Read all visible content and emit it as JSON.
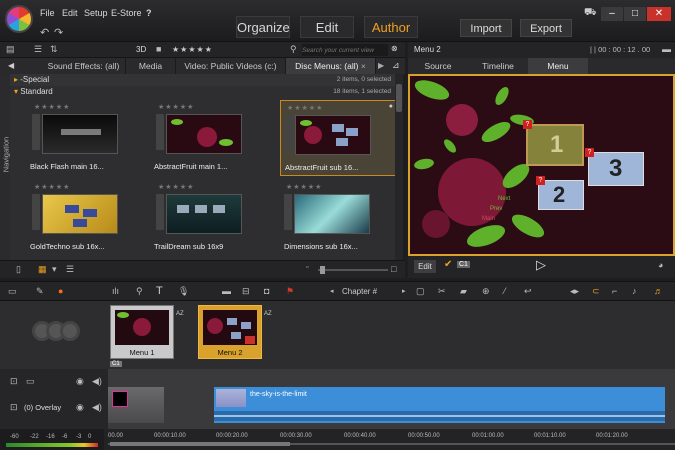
{
  "menubar": {
    "file": "File",
    "edit": "Edit",
    "setup": "Setup",
    "estore": "E-Store",
    "help_icon": "?"
  },
  "nav": {
    "organize": "Organize",
    "edit": "Edit",
    "author": "Author",
    "accent": "#f0a020"
  },
  "topbuttons": {
    "import": "Import",
    "export": "Export"
  },
  "window": {
    "minimize": "–",
    "maximize": "□",
    "close": "✕"
  },
  "libtoolbar": {
    "mode_3d": "3D",
    "rating": "★★★★★",
    "search_placeholder": "Search your current view"
  },
  "libtabs": [
    "Sound Effects: (all)",
    "Media",
    "Video: Public Videos (c:)",
    "Disc Menus: (all)"
  ],
  "navigation_label": "Navigation",
  "groups": [
    {
      "name": "-Special",
      "count": "2 items, 0 selected"
    },
    {
      "name": "Standard",
      "count": "18 items, 1 selected"
    }
  ],
  "tiles": [
    {
      "label": "Black Flash main 16...",
      "stars": "★★★★★",
      "thumb": "black"
    },
    {
      "label": "AbstractFruit main 1...",
      "stars": "★★★★★",
      "thumb": "fruit"
    },
    {
      "label": "AbstractFruit sub 16...",
      "stars": "★★★★★",
      "thumb": "fruitsub",
      "selected": true
    },
    {
      "label": "GoldTechno sub 16x...",
      "stars": "★★★★★",
      "thumb": "gold"
    },
    {
      "label": "TrailDream sub 16x9",
      "stars": "★★★★★",
      "thumb": "trail"
    },
    {
      "label": "Dimensions sub 16x...",
      "stars": "★★★★★",
      "thumb": "dim"
    }
  ],
  "preview": {
    "title": "Menu 2",
    "timecode": "| | 00 : 00 : 12 . 00",
    "tabs": [
      "Source",
      "Timeline",
      "Menu"
    ],
    "buttons": [
      {
        "num": "1",
        "badge": "?"
      },
      {
        "num": "2",
        "badge": "?"
      },
      {
        "num": "3",
        "badge": "?"
      }
    ],
    "next_text": "Next",
    "prev_text": "Prev",
    "main_text": "Main",
    "edit_label": "Edit",
    "c1_label": "C1"
  },
  "timeline": {
    "chapter_label": "Chapter #",
    "menus": [
      {
        "label": "Menu 1",
        "tag": "AZ"
      },
      {
        "label": "Menu 2",
        "tag": "AZ",
        "selected": true
      }
    ],
    "c1_marker": "C1",
    "overlay_track": "(0) Overlay",
    "clip_title": "the-sky-is-the-limit",
    "ruler": [
      "00.00",
      "00:00:10.00",
      "00:00:20.00",
      "00:00:30.00",
      "00:00:40.00",
      "00:00:50.00",
      "00:01:00.00",
      "00:01:10.00",
      "00:01:20.00"
    ],
    "meter": [
      "-60",
      "-22",
      "-16",
      "-6",
      "-3",
      "0"
    ]
  }
}
